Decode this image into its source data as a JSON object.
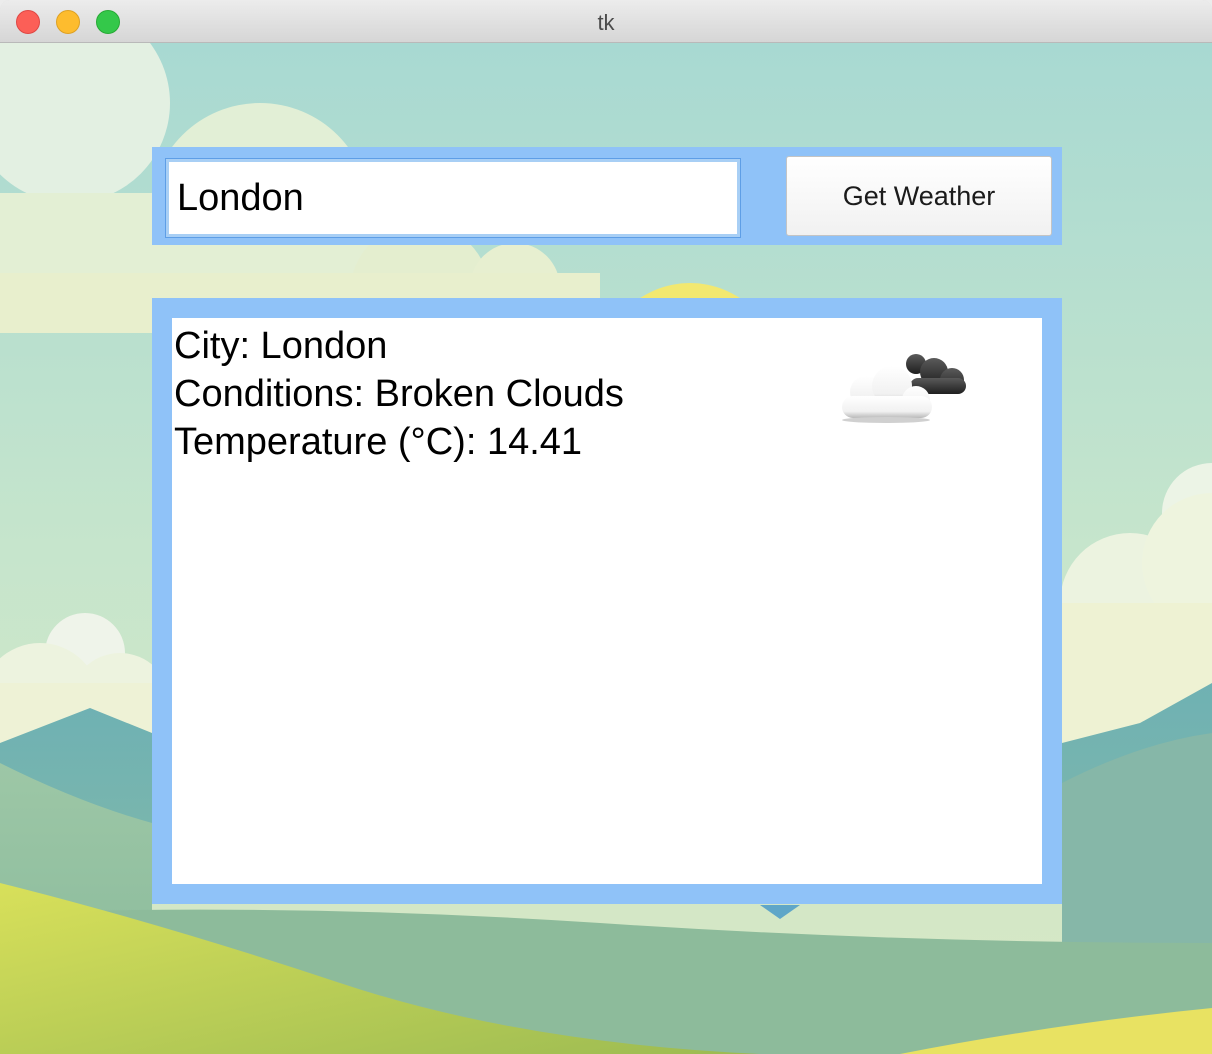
{
  "window": {
    "title": "tk"
  },
  "search": {
    "city_value": "London",
    "button_label": "Get Weather"
  },
  "result": {
    "city_line": "City: London",
    "conditions_line": "Conditions: Broken Clouds",
    "temperature_line": "Temperature (°C): 14.41",
    "icon": "broken-clouds-icon"
  },
  "colors": {
    "frame": "#8fc2f8",
    "panel": "#ffffff"
  }
}
